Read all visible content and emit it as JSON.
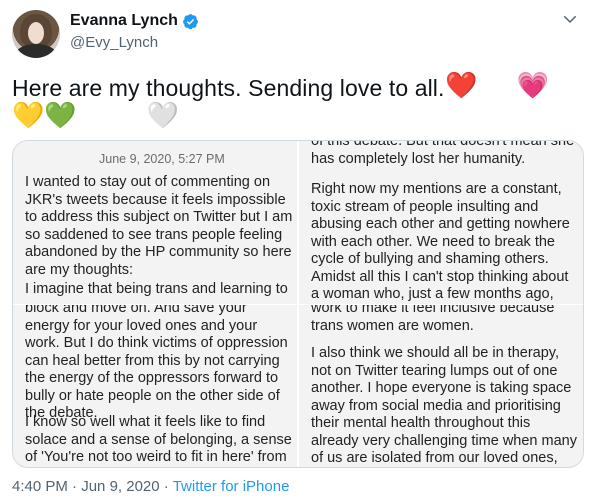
{
  "author": {
    "name": "Evanna Lynch",
    "handle": "@Evy_Lynch",
    "verified": true
  },
  "tweet": {
    "text": "Here are my thoughts. Sending love to all.",
    "emojis_row1": [
      "❤️",
      "💗"
    ],
    "emojis_row2": [
      "💛",
      "💚",
      "🤍"
    ]
  },
  "image": {
    "date": "June 9, 2020, 5:27 PM",
    "p1": "I wanted to stay out of commenting on JKR's tweets because it feels impossible to address this subject on Twitter but I am so saddened to see trans people feeling abandoned by the HP community so here are my thoughts:",
    "p2": "I imagine that being trans and learning to",
    "p3": "block and move on. And save your energy for your loved ones and your work. But I do think victims of oppression can heal better from this by not carrying the energy of the oppressors forward to bully or hate people on the other side of the debate.",
    "p4": "I know so well what it feels like to find solace and a sense of belonging, a sense of 'You're not too weird to fit in here' from",
    "p5": "of this debate. But that doesn't mean she has completely lost her humanity.",
    "p6": "Right now my mentions are a constant, toxic stream of people insulting and abusing each other and getting nowhere with each other. We need to break the cycle of bullying and shaming others. Amidst all this I can't stop thinking about a woman who, just a few months ago, was bullied and publicly shamed by the media and strangers online,",
    "p7": "work to make it feel inclusive because trans women are women.",
    "p8": "I also think we should all be in therapy, not on Twitter tearing lumps out of one another. I hope everyone is taking space away from social media and prioritising their mental health throughout this already very challenging time when many of us are isolated from our loved ones, because it is a lot, and it isn't going to get resolved here."
  },
  "footer": {
    "time": "4:40 PM",
    "sep": "·",
    "date": "Jun 9, 2020",
    "source": "Twitter for iPhone"
  },
  "colors": {
    "accent": "#1d9bf0",
    "muted": "#536471"
  }
}
